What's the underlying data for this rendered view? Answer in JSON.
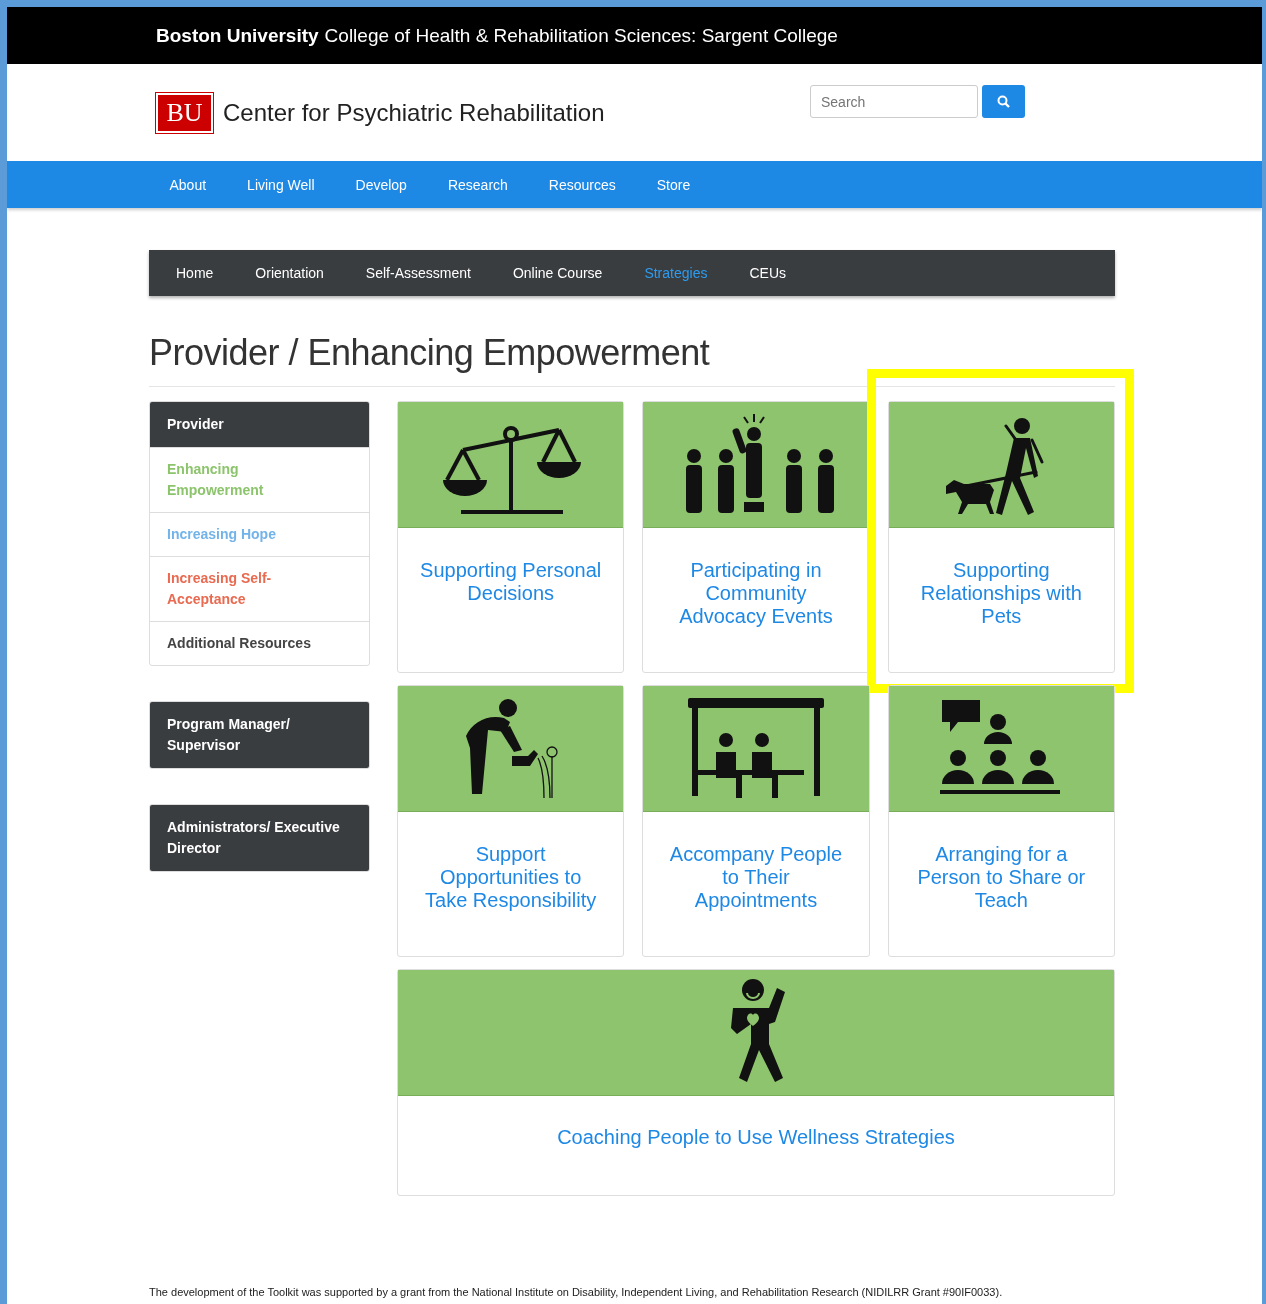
{
  "topbar": {
    "university": "Boston University",
    "college": "College of Health & Rehabilitation Sciences: Sargent College"
  },
  "header": {
    "logo": "BU",
    "title": "Center for Psychiatric Rehabilitation",
    "search": {
      "placeholder": "Search"
    }
  },
  "main_nav": [
    "About",
    "Living Well",
    "Develop",
    "Research",
    "Resources",
    "Store"
  ],
  "sub_nav": [
    {
      "label": "Home",
      "selected": false
    },
    {
      "label": "Orientation",
      "selected": false
    },
    {
      "label": "Self-Assessment",
      "selected": false
    },
    {
      "label": "Online Course",
      "selected": false
    },
    {
      "label": "Strategies",
      "selected": true
    },
    {
      "label": "CEUs",
      "selected": false
    }
  ],
  "page_title": "Provider / Enhancing Empowerment",
  "sidebar": [
    {
      "heading": "Provider",
      "items": [
        {
          "label": "Enhancing Empowerment",
          "color": "#8cc46c"
        },
        {
          "label": "Increasing Hope",
          "color": "#72b3ea"
        },
        {
          "label": "Increasing Self-Acceptance",
          "color": "#e96a50"
        },
        {
          "label": "Additional Resources",
          "color": "#444444"
        }
      ]
    },
    {
      "heading": "Program Manager/ Supervisor"
    },
    {
      "heading": "Administrators/ Executive Director"
    }
  ],
  "cards": [
    {
      "title": "Supporting Personal Decisions",
      "highlighted": false
    },
    {
      "title": "Participating in Community Advocacy Events",
      "highlighted": false
    },
    {
      "title": "Supporting Relationships with Pets",
      "highlighted": true
    },
    {
      "title": "Support Opportunities to Take Responsibility",
      "highlighted": false
    },
    {
      "title": "Accompany People to Their Appointments",
      "highlighted": false
    },
    {
      "title": "Arranging for a Person to Share or Teach",
      "highlighted": false
    },
    {
      "title": "Coaching People to Use Wellness Strategies",
      "highlighted": false
    }
  ],
  "footer": "The development of the Toolkit was supported by a grant from the National Institute on Disability, Independent Living, and Rehabilitation Research (NIDILRR Grant #90IF0033)."
}
